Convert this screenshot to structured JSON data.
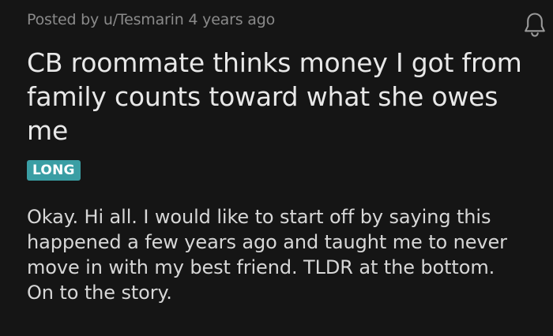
{
  "post": {
    "meta": "Posted by u/Tesmarin 4 years ago",
    "title": "CB roommate thinks money I got from family counts toward what she owes me",
    "flair": "LONG",
    "body": "Okay. Hi all. I would like to start off by saying this happened a few years ago and taught me to never move in with my best friend. TLDR at the bottom. On to the story."
  },
  "icons": {
    "notification": "bell-icon"
  },
  "colors": {
    "background": "#151515",
    "flair": "#3a9ea4",
    "meta_text": "#8a8a8a",
    "title_text": "#e8e8e8",
    "body_text": "#d7d7d7"
  }
}
